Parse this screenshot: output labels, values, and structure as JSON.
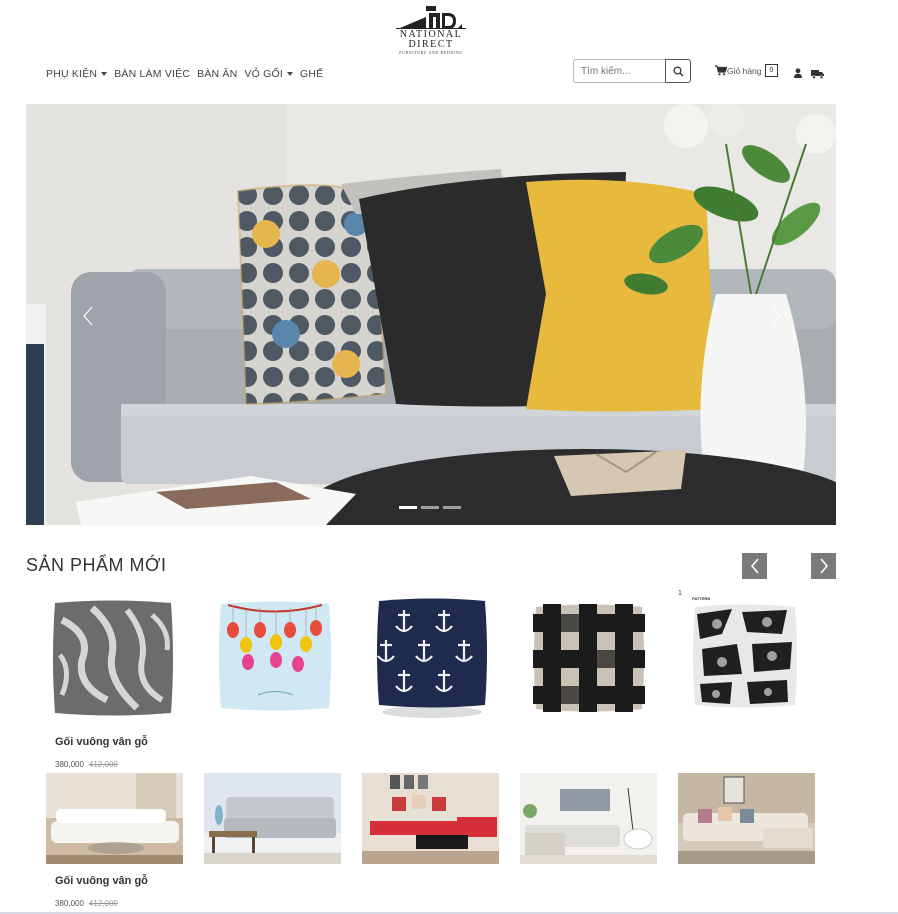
{
  "header": {
    "brand": "NATIONAL DIRECT",
    "tagline": "FURNITURE AND BEDDING"
  },
  "nav": {
    "items": [
      {
        "label": "PHỤ KIỆN",
        "dropdown": true
      },
      {
        "label": "BÀN LÀM VIỆC",
        "dropdown": false
      },
      {
        "label": "BÀN ĂN",
        "dropdown": false
      },
      {
        "label": "VỎ GỐI",
        "dropdown": true
      },
      {
        "label": "GHẾ",
        "dropdown": false
      }
    ]
  },
  "search": {
    "placeholder": "Tìm kiếm..."
  },
  "cart": {
    "label": "Giỏ hàng",
    "count": "0"
  },
  "hero": {
    "slides": 3,
    "active_slide": 1
  },
  "section": {
    "title": "SẢN PHẨM MỚI"
  },
  "products": [
    {
      "name": "Gối vuông vân gỗ",
      "price": "380,000",
      "old_price": "412,000"
    },
    {
      "name": "Gối vuông vân gỗ",
      "price": "380,000",
      "old_price": "412,000"
    }
  ],
  "pillow_badge": "1",
  "pillow_badge_text": "PATTERN",
  "icons": [
    "search-icon",
    "cart-icon",
    "user-icon",
    "truck-icon",
    "chevron-left-icon",
    "chevron-right-icon"
  ],
  "colors": {
    "nav_text": "#444444",
    "slider_button": "#7a7a7a"
  }
}
